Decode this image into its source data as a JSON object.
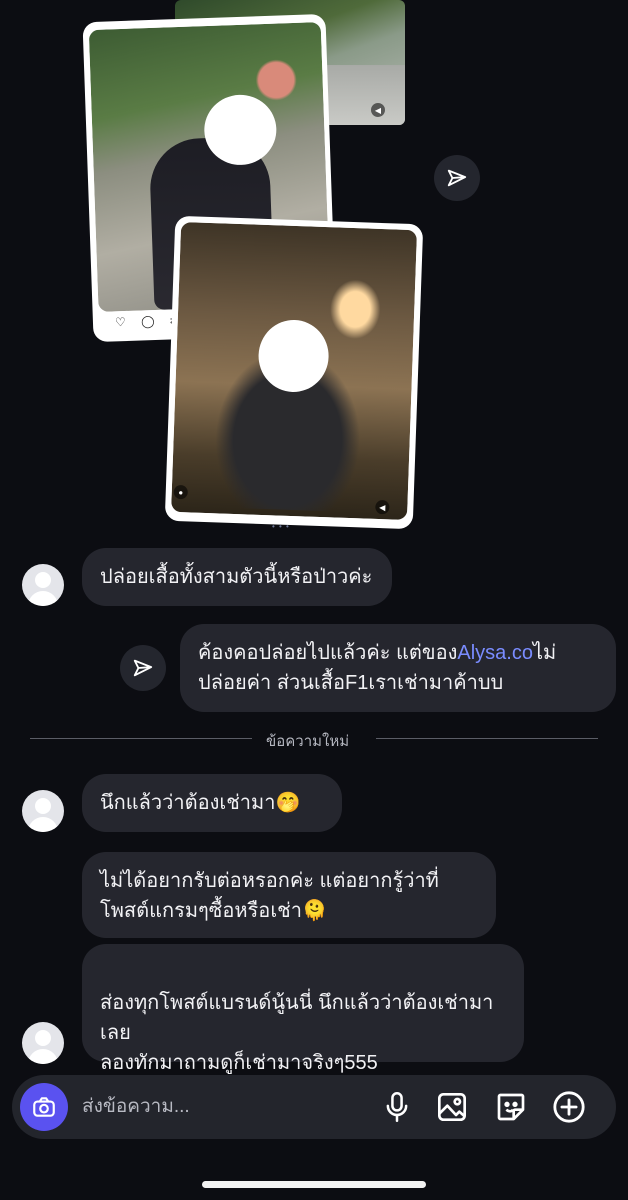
{
  "shared_post": {
    "top_strip": "video-thumbnail",
    "post_icons": "heart-icon comment-icon repost-icon share-icon",
    "carousel_dots": "• • •"
  },
  "messages": [
    {
      "id": "m1",
      "sender": "them",
      "text": "ปล่อยเสื้อทั้งสามตัวนี้หรือป่าวค่ะ"
    },
    {
      "id": "m2",
      "sender": "me",
      "text_before": "ค้องคอปล่อยไปแล้วค่ะ แต่ของ",
      "link": "Alysa.co",
      "text_after": "ไม่ปล่อยค่า ส่วนเสื้อF1เราเช่ามาค้าบบ"
    },
    {
      "id": "m3",
      "sender": "them",
      "text": "นึกแล้วว่าต้องเช่ามา🤭"
    },
    {
      "id": "m4",
      "sender": "them",
      "text": "ไม่ได้อยากรับต่อหรอกค่ะ แต่อยากรู้ว่าที่โพสต์แกรมๆซื้อหรือเช่า🫠"
    },
    {
      "id": "m5",
      "sender": "them",
      "text": "ส่องทุกโพสต์แบรนด์นู้นนี่ นึกแล้วว่าต้องเช่ามาเลย\nลองทักมาถามดูก็เช่ามาจริงๆ555"
    }
  ],
  "divider": {
    "label": "ข้อความใหม่"
  },
  "composer": {
    "placeholder": "ส่งข้อความ...",
    "tools": [
      "mic-icon",
      "image-icon",
      "sticker-icon",
      "plus-icon"
    ]
  },
  "colors": {
    "background": "#0c0d12",
    "bubble": "#25262e",
    "link": "#7a8cff",
    "camera_button": "#5a52f0"
  }
}
